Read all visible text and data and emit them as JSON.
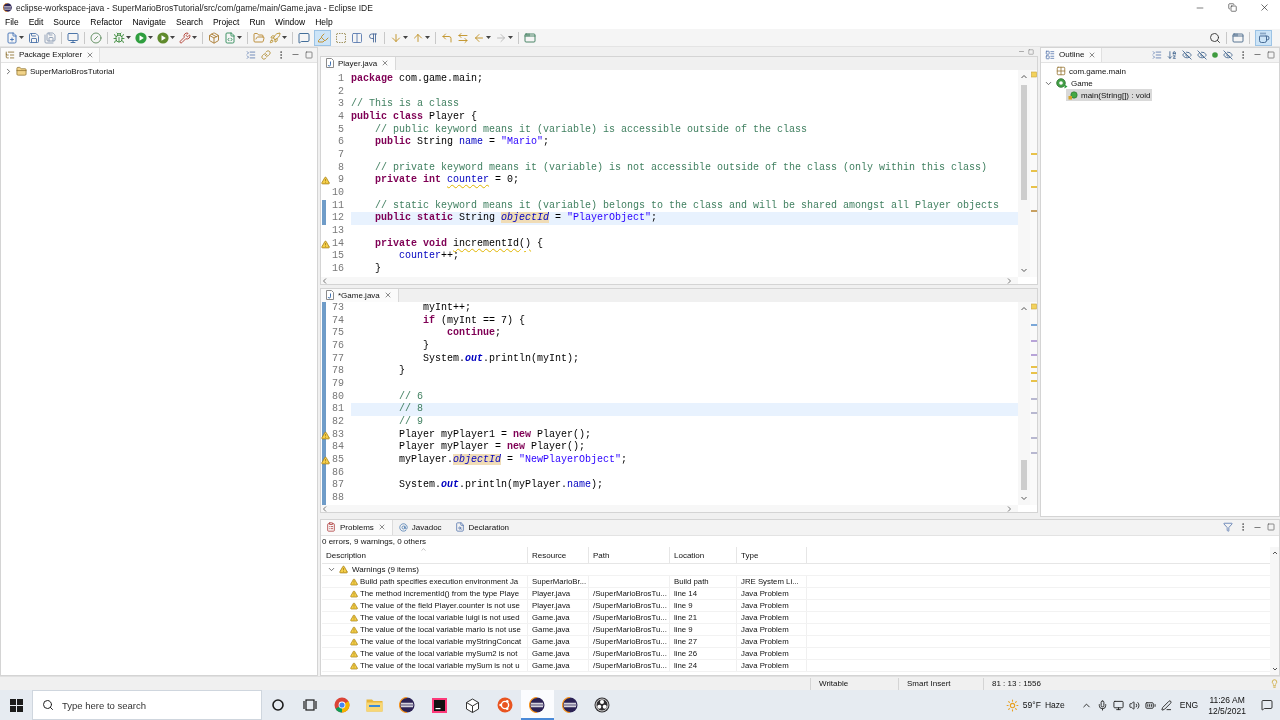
{
  "window": {
    "title": "eclipse-workspace-java - SuperMarioBrosTutorial/src/com/game/main/Game.java - Eclipse IDE"
  },
  "menu": [
    "File",
    "Edit",
    "Source",
    "Refactor",
    "Navigate",
    "Search",
    "Project",
    "Run",
    "Window",
    "Help"
  ],
  "toolbar": {
    "mark_occurrences_on": true,
    "java_perspective_selected": true
  },
  "package_explorer": {
    "title": "Package Explorer",
    "items": [
      {
        "label": "SuperMarioBrosTutorial",
        "kind": "project",
        "selected": false,
        "expanded": false
      }
    ]
  },
  "editors": [
    {
      "tabs": [
        {
          "label": "Player.java",
          "selected": true
        }
      ],
      "lines": [
        {
          "number": "1",
          "changed": false,
          "current": false,
          "warning": false,
          "tokens": [
            {
              "kind": "keyword",
              "text": "package"
            },
            {
              "kind": "text",
              "text": " com.game.main;"
            }
          ]
        },
        {
          "number": "2",
          "changed": false,
          "current": false,
          "warning": false
        },
        {
          "number": "3",
          "changed": false,
          "current": false,
          "warning": false,
          "tokens": [
            {
              "kind": "comment",
              "text": "// This is a class"
            }
          ]
        },
        {
          "number": "4",
          "changed": false,
          "current": false,
          "warning": false,
          "tokens": [
            {
              "kind": "keyword",
              "text": "public class "
            },
            {
              "kind": "text",
              "text": "Player {"
            }
          ]
        },
        {
          "number": "5",
          "changed": false,
          "current": false,
          "warning": false,
          "tokens": [
            {
              "kind": "comment",
              "text": "    // public keyword means it (variable) is accessible outside of the class"
            }
          ]
        },
        {
          "number": "6",
          "changed": false,
          "current": false,
          "warning": false,
          "tokens": [
            {
              "kind": "keyword",
              "text": "    public "
            },
            {
              "kind": "text",
              "text": "String "
            },
            {
              "kind": "field",
              "text": "name"
            },
            {
              "kind": "text",
              "text": " = "
            },
            {
              "kind": "string",
              "text": "\"Mario\""
            },
            {
              "kind": "text",
              "text": ";"
            }
          ]
        },
        {
          "number": "7",
          "changed": false,
          "current": false,
          "warning": false
        },
        {
          "number": "8",
          "changed": false,
          "current": false,
          "warning": false,
          "tokens": [
            {
              "kind": "comment",
              "text": "    // private keyword means it (variable) is not accessible outside of the class (only within this class)"
            }
          ]
        },
        {
          "number": "9",
          "changed": false,
          "current": false,
          "warning": true,
          "tokens": [
            {
              "kind": "keyword",
              "text": "    private int "
            },
            {
              "kind": "unusedfield",
              "text": "counter"
            },
            {
              "kind": "text",
              "text": " = 0;"
            }
          ]
        },
        {
          "number": "10",
          "changed": false,
          "current": false,
          "warning": false
        },
        {
          "number": "11",
          "changed": true,
          "current": false,
          "warning": false,
          "tokens": [
            {
              "kind": "comment",
              "text": "    // static keyword means it (variable) belongs to the class and will be shared amongst all Player objects"
            }
          ]
        },
        {
          "number": "12",
          "changed": true,
          "current": true,
          "warning": false,
          "tokens": [
            {
              "kind": "keyword",
              "text": "    public static "
            },
            {
              "kind": "text",
              "text": "String "
            },
            {
              "kind": "occurrence",
              "text": "objectId"
            },
            {
              "kind": "text",
              "text": " = "
            },
            {
              "kind": "string",
              "text": "\"PlayerObject\""
            },
            {
              "kind": "text",
              "text": ";"
            }
          ]
        },
        {
          "number": "13",
          "changed": false,
          "current": false,
          "warning": false
        },
        {
          "number": "14",
          "changed": false,
          "current": false,
          "warning": true,
          "tokens": [
            {
              "kind": "keyword",
              "text": "    private void "
            },
            {
              "kind": "unusedmethod",
              "text": "incrementId()"
            },
            {
              "kind": "text",
              "text": " {"
            }
          ]
        },
        {
          "number": "15",
          "changed": false,
          "current": false,
          "warning": false,
          "tokens": [
            {
              "kind": "field",
              "text": "        counter"
            },
            {
              "kind": "text",
              "text": "++;"
            }
          ]
        },
        {
          "number": "16",
          "changed": false,
          "current": false,
          "warning": false,
          "tokens": [
            {
              "kind": "text",
              "text": "    }"
            }
          ]
        }
      ]
    },
    {
      "tabs": [
        {
          "label": "*Game.java",
          "selected": true
        }
      ],
      "lines": [
        {
          "number": "73",
          "changed": true,
          "current": false,
          "warning": false,
          "tokens": [
            {
              "kind": "text",
              "text": "            myInt++;"
            }
          ]
        },
        {
          "number": "74",
          "changed": true,
          "current": false,
          "warning": false,
          "tokens": [
            {
              "kind": "keyword",
              "text": "            if"
            },
            {
              "kind": "text",
              "text": " (myInt == 7) {"
            }
          ]
        },
        {
          "number": "75",
          "changed": true,
          "current": false,
          "warning": false,
          "tokens": [
            {
              "kind": "keyword",
              "text": "                continue"
            },
            {
              "kind": "text",
              "text": ";"
            }
          ]
        },
        {
          "number": "76",
          "changed": true,
          "current": false,
          "warning": false,
          "tokens": [
            {
              "kind": "text",
              "text": "            }"
            }
          ]
        },
        {
          "number": "77",
          "changed": true,
          "current": false,
          "warning": false,
          "tokens": [
            {
              "kind": "text",
              "text": "            System."
            },
            {
              "kind": "constant",
              "text": "out"
            },
            {
              "kind": "text",
              "text": ".println(myInt);"
            }
          ]
        },
        {
          "number": "78",
          "changed": true,
          "current": false,
          "warning": false,
          "tokens": [
            {
              "kind": "text",
              "text": "        }"
            }
          ]
        },
        {
          "number": "79",
          "changed": true,
          "current": false,
          "warning": false
        },
        {
          "number": "80",
          "changed": true,
          "current": false,
          "warning": false,
          "tokens": [
            {
              "kind": "comment",
              "text": "        // 6"
            }
          ]
        },
        {
          "number": "81",
          "changed": true,
          "current": true,
          "warning": false,
          "tokens": [
            {
              "kind": "comment",
              "text": "        // 8"
            }
          ]
        },
        {
          "number": "82",
          "changed": true,
          "current": false,
          "warning": false,
          "tokens": [
            {
              "kind": "comment",
              "text": "        // 9"
            }
          ]
        },
        {
          "number": "83",
          "changed": true,
          "current": false,
          "warning": true,
          "tokens": [
            {
              "kind": "text",
              "text": "        Player myPlayer1 = "
            },
            {
              "kind": "keyword",
              "text": "new"
            },
            {
              "kind": "text",
              "text": " Player();"
            }
          ]
        },
        {
          "number": "84",
          "changed": true,
          "current": false,
          "warning": false,
          "tokens": [
            {
              "kind": "text",
              "text": "        Player myPlayer = "
            },
            {
              "kind": "keyword",
              "text": "new"
            },
            {
              "kind": "text",
              "text": " Player();"
            }
          ]
        },
        {
          "number": "85",
          "changed": true,
          "current": false,
          "warning": true,
          "tokens": [
            {
              "kind": "text",
              "text": "        myPlayer."
            },
            {
              "kind": "occurrence",
              "text": "objectId"
            },
            {
              "kind": "text",
              "text": " = "
            },
            {
              "kind": "string",
              "text": "\"NewPlayerObject\""
            },
            {
              "kind": "text",
              "text": ";"
            }
          ]
        },
        {
          "number": "86",
          "changed": true,
          "current": false,
          "warning": false
        },
        {
          "number": "87",
          "changed": true,
          "current": false,
          "warning": false,
          "tokens": [
            {
              "kind": "text",
              "text": "        System."
            },
            {
              "kind": "constant",
              "text": "out"
            },
            {
              "kind": "text",
              "text": ".println(myPlayer."
            },
            {
              "kind": "field",
              "text": "name"
            },
            {
              "kind": "text",
              "text": ");"
            }
          ]
        },
        {
          "number": "88",
          "changed": true,
          "current": false,
          "warning": false
        }
      ]
    }
  ],
  "outline": {
    "title": "Outline",
    "items": [
      {
        "label": "com.game.main",
        "kind": "package",
        "selected": false
      },
      {
        "label": "Game",
        "kind": "class",
        "selected": false,
        "expanded": true,
        "children": [
          {
            "label": "main(String[]) : void",
            "kind": "method",
            "selected": true
          }
        ]
      }
    ]
  },
  "problems": {
    "tabs": [
      {
        "label": "Problems",
        "kind": "problems",
        "selected": true
      },
      {
        "label": "Javadoc",
        "kind": "javadoc",
        "selected": false
      },
      {
        "label": "Declaration",
        "kind": "declaration",
        "selected": false
      }
    ],
    "summary": "0 errors, 9 warnings, 0 others",
    "columns": [
      "Description",
      "Resource",
      "Path",
      "Location",
      "Type"
    ],
    "groups": [
      {
        "label": "Warnings (9 items)",
        "expanded": true,
        "rows": [
          {
            "description": "Build path specifies execution environment Ja",
            "resource": "SuperMarioBr...",
            "location": "Build path",
            "type": "JRE System Li..."
          },
          {
            "description": "The method incrementId() from the type Playe",
            "resource": "Player.java",
            "path": "/SuperMarioBrosTu...",
            "location": "line 14",
            "type": "Java Problem"
          },
          {
            "description": "The value of the field Player.counter is not use",
            "resource": "Player.java",
            "path": "/SuperMarioBrosTu...",
            "location": "line 9",
            "type": "Java Problem"
          },
          {
            "description": "The value of the local variable luigi is not used",
            "resource": "Game.java",
            "path": "/SuperMarioBrosTu...",
            "location": "line 21",
            "type": "Java Problem"
          },
          {
            "description": "The value of the local variable mario is not use",
            "resource": "Game.java",
            "path": "/SuperMarioBrosTu...",
            "location": "line 9",
            "type": "Java Problem"
          },
          {
            "description": "The value of the local variable myStringConcat",
            "resource": "Game.java",
            "path": "/SuperMarioBrosTu...",
            "location": "line 27",
            "type": "Java Problem"
          },
          {
            "description": "The value of the local variable mySum2 is not",
            "resource": "Game.java",
            "path": "/SuperMarioBrosTu...",
            "location": "line 26",
            "type": "Java Problem"
          },
          {
            "description": "The value of the local variable mySum is not u",
            "resource": "Game.java",
            "path": "/SuperMarioBrosTu...",
            "location": "line 24",
            "type": "Java Problem"
          }
        ]
      }
    ]
  },
  "status_bar": [
    "Writable",
    "Smart Insert",
    "81 : 13 : 1556"
  ],
  "taskbar": {
    "search_placeholder": "Type here to search",
    "apps": [
      {
        "kind": "browser",
        "active": false
      },
      {
        "kind": "folder",
        "active": false
      },
      {
        "kind": "ide",
        "active": false
      },
      {
        "kind": "square",
        "active": false
      },
      {
        "kind": "cube",
        "active": false
      },
      {
        "kind": "circle",
        "active": false
      },
      {
        "kind": "ide",
        "active": true
      },
      {
        "kind": "ide",
        "active": false
      },
      {
        "kind": "recorder",
        "active": false
      }
    ],
    "weather": {
      "temperature": "59°F",
      "condition": "Haze"
    },
    "language": "ENG",
    "time": "11:26 AM",
    "date": "12/5/2021"
  }
}
